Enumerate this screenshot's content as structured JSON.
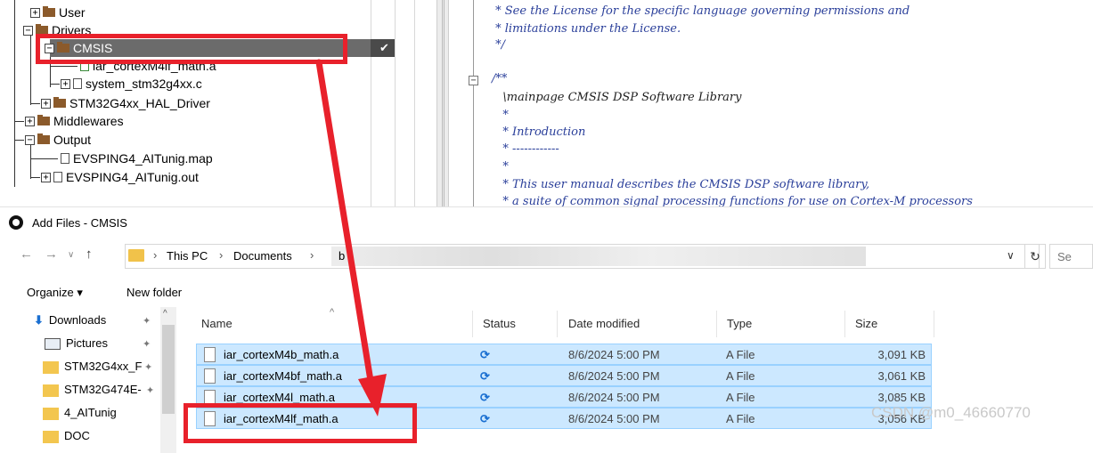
{
  "tree": {
    "rows": [
      {
        "label": "User"
      },
      {
        "label": "Drivers"
      },
      {
        "label": "CMSIS"
      },
      {
        "label": "iar_cortexM4lf_math.a"
      },
      {
        "label": "system_stm32g4xx.c"
      },
      {
        "label": "STM32G4xx_HAL_Driver"
      },
      {
        "label": "Middlewares"
      },
      {
        "label": "Output"
      },
      {
        "label": "EVSPING4_AITunig.map"
      },
      {
        "label": "EVSPING4_AITunig.out"
      }
    ],
    "check_mark": "✔"
  },
  "code": {
    "lines": [
      " * See the License for the specific language governing permissions and",
      " * limitations under the License.",
      " */",
      "/**",
      "   \\mainpage CMSIS DSP Software Library",
      "   *",
      "   * Introduction",
      "   * ------------",
      "   *",
      "   * This user manual describes the CMSIS DSP software library,",
      "   * a suite of common signal processing functions for use on Cortex-M processors"
    ]
  },
  "dialog": {
    "title": "Add Files - CMSIS",
    "breadcrumbs": [
      "This PC",
      "Documents"
    ],
    "crumb_sep": "›",
    "crumb_partial": "b",
    "search_placeholder": "Se",
    "toolbar": {
      "organize": "Organize ▾",
      "new_folder": "New folder"
    },
    "nav": [
      {
        "label": "Downloads",
        "pinned": true
      },
      {
        "label": "Pictures",
        "pinned": true
      },
      {
        "label": "STM32G4xx_F",
        "pinned": true
      },
      {
        "label": "STM32G474E-",
        "pinned": true
      },
      {
        "label": "4_AITunig",
        "pinned": false
      },
      {
        "label": "DOC",
        "pinned": false
      }
    ],
    "columns": [
      "Name",
      "Status",
      "Date modified",
      "Type",
      "Size"
    ],
    "files": [
      {
        "name": "iar_cortexM4b_math.a",
        "date": "8/6/2024 5:00 PM",
        "type": "A File",
        "size": "3,091 KB"
      },
      {
        "name": "iar_cortexM4bf_math.a",
        "date": "8/6/2024 5:00 PM",
        "type": "A File",
        "size": "3,061 KB"
      },
      {
        "name": "iar_cortexM4l_math.a",
        "date": "8/6/2024 5:00 PM",
        "type": "A File",
        "size": "3,085 KB"
      },
      {
        "name": "iar_cortexM4lf_math.a",
        "date": "8/6/2024 5:00 PM",
        "type": "A File",
        "size": "3,056 KB"
      }
    ]
  },
  "watermark": "CSDN @m0_46660770",
  "colors": {
    "annotation": "#e8212b",
    "selection": "#cce8ff"
  }
}
